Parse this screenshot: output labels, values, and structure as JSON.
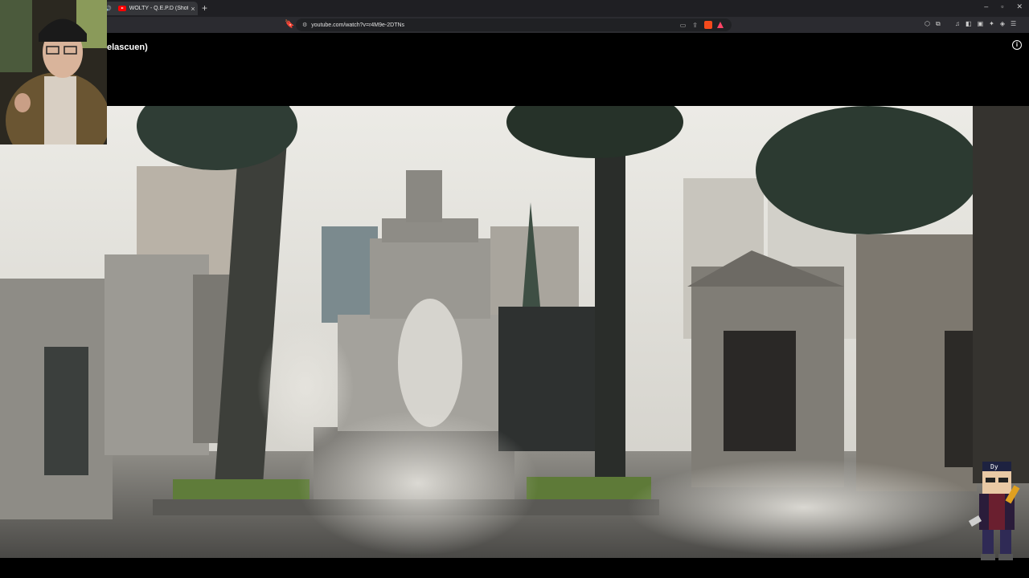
{
  "browser": {
    "tab_title": "WOLTY - Q.E.P.D (Shot by Be",
    "tab_close": "×",
    "new_tab": "+",
    "window_controls": [
      "–",
      "▫",
      "✕"
    ],
    "url": "youtube.com/watch?v=r4M9e-2DTNs"
  },
  "video": {
    "title_fragment": "elascuen)",
    "info": "i"
  },
  "overlay": {
    "mascot_label": "Dy"
  }
}
